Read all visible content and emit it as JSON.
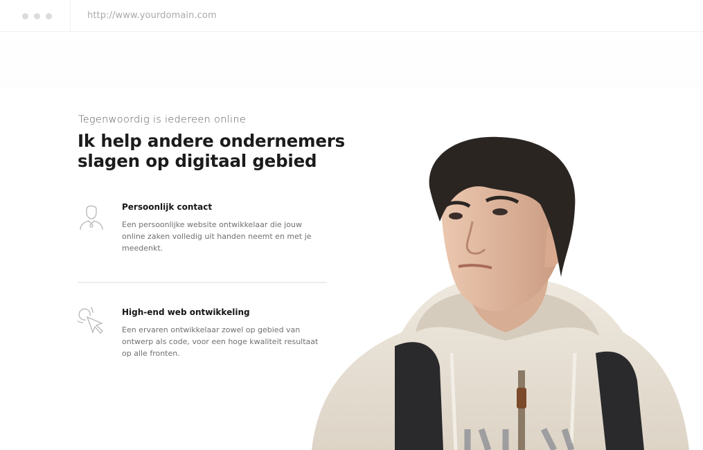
{
  "browser": {
    "url": "http://www.yourdomain.com"
  },
  "hero": {
    "eyebrow": "Tegenwoordig is iedereen online",
    "headline_line1": "Ik help andere ondernemers",
    "headline_line2": "slagen op digitaal gebied"
  },
  "features": [
    {
      "icon": "person-icon",
      "title": "Persoonlijk contact",
      "description": "Een persoonlijke website ontwikkelaar die jouw online zaken volledig uit handen neemt en met je meedenkt."
    },
    {
      "icon": "cursor-click-icon",
      "title": "High-end web ontwikkeling",
      "description": "Een ervaren ontwikkelaar zowel op gebied van ontwerp als code, voor een hoge kwaliteit resultaat op alle fronten."
    }
  ],
  "colors": {
    "heading": "#1b1b1b",
    "body_text": "#6f6f6f",
    "icon_stroke": "#b5b5b5",
    "hoodie": "#e9e2d6",
    "hair": "#2b2522",
    "skin": "#e0b9a0"
  }
}
